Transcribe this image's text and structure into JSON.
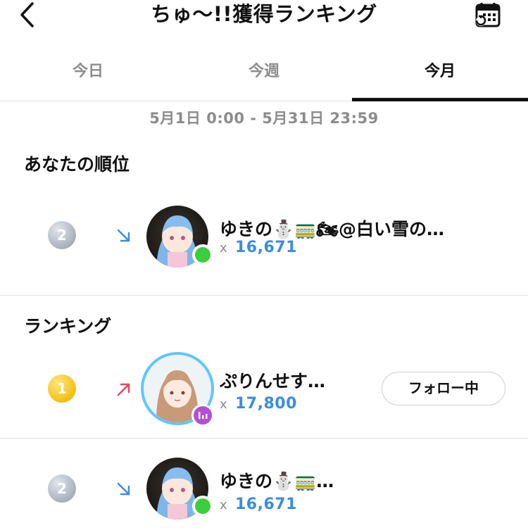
{
  "header": {
    "title": "ちゅ～!!獲得ランキング",
    "back_icon": "chevron-left-icon",
    "calendar_icon": "calendar-history-icon"
  },
  "tabs": [
    {
      "label": "今日",
      "active": false
    },
    {
      "label": "今週",
      "active": false
    },
    {
      "label": "今月",
      "active": true
    }
  ],
  "period": "5月1日 0:00 - 5月31日 23:59",
  "my_rank": {
    "section_title": "あなたの順位",
    "rank": "2",
    "trend": "down",
    "name": "ゆきの⛄🚃🏍@白い雪の…",
    "x": "x",
    "count": "16,671",
    "status": "online"
  },
  "ranking": {
    "section_title": "ランキング",
    "entries": [
      {
        "rank": "1",
        "trend": "up",
        "name": "ぷりんせす…",
        "x": "x",
        "count": "17,800",
        "status": "live",
        "follow_label": "フォロー中"
      },
      {
        "rank": "2",
        "trend": "down",
        "name": "ゆきの⛄🚃…",
        "x": "x",
        "count": "16,671",
        "status": "online"
      }
    ]
  },
  "colors": {
    "accent_count": "#3a8de0",
    "trend_up": "#e8455e",
    "trend_down": "#3a8de0",
    "online": "#3ccf3c",
    "live": "#b34fd6",
    "gold": "#f4c21a",
    "silver": "#a8b0bc"
  }
}
